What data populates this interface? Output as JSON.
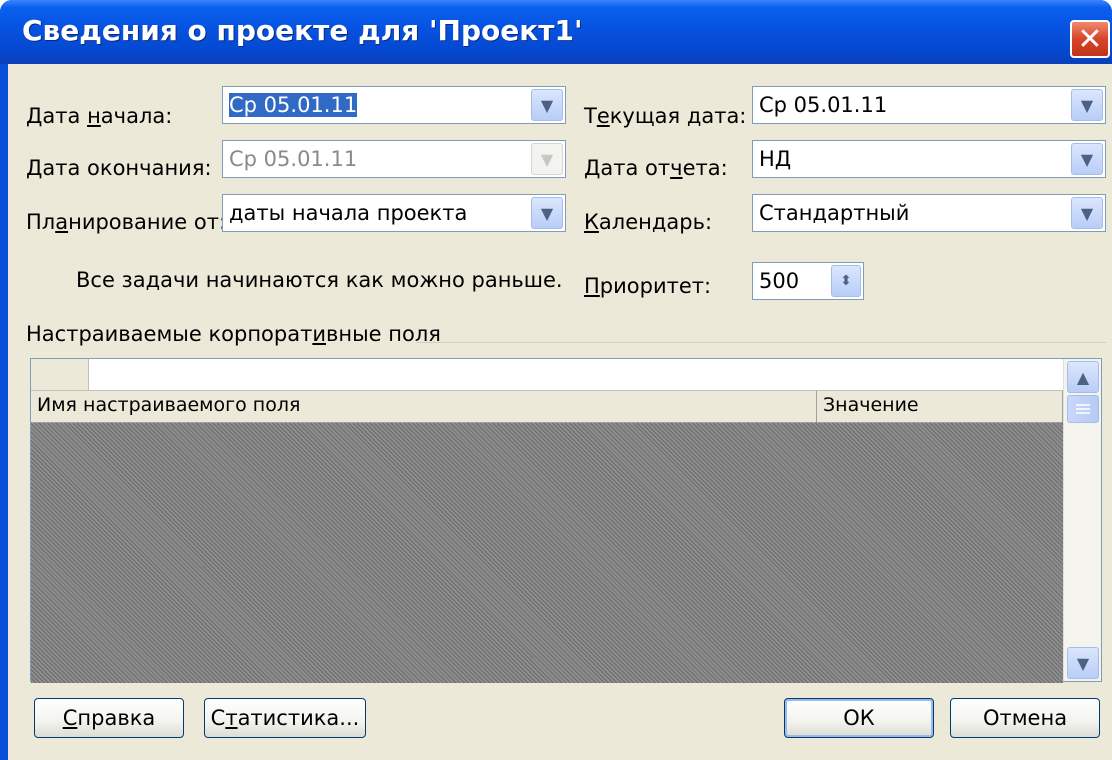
{
  "window": {
    "title": "Сведения о проекте для 'Проект1'",
    "close_glyph": "✕"
  },
  "left": {
    "start_label_pre": "Дата ",
    "start_label_u": "н",
    "start_label_post": "ачала:",
    "start_value": "Ср 05.01.11",
    "finish_label_pre": "",
    "finish_label_u": "Д",
    "finish_label_post": "ата окончания:",
    "finish_value": "Ср 05.01.11",
    "schedule_label_pre": "Пл",
    "schedule_label_u": "а",
    "schedule_label_post": "нирование от:",
    "schedule_value": "даты начала проекта",
    "note": "Все задачи начинаются как можно раньше."
  },
  "right": {
    "current_label_pre": "Т",
    "current_label_u": "е",
    "current_label_post": "кущая дата:",
    "current_value": "Ср 05.01.11",
    "status_label_pre": "Дата от",
    "status_label_u": "ч",
    "status_label_post": "ета:",
    "status_value": "НД",
    "calendar_label_pre": "",
    "calendar_label_u": "К",
    "calendar_label_post": "алендарь:",
    "calendar_value": "Стандартный",
    "priority_label_pre": "",
    "priority_label_u": "П",
    "priority_label_post": "риоритет:",
    "priority_value": "500"
  },
  "custom_fields": {
    "group_label_pre": "Настраиваемые корпорат",
    "group_label_u": "и",
    "group_label_post": "вные поля",
    "columns": [
      "Имя настраиваемого поля",
      "Значение"
    ]
  },
  "buttons": {
    "help_u": "С",
    "help_post": "правка",
    "stats_pre": "С",
    "stats_u": "т",
    "stats_post": "атистика...",
    "ok": "ОК",
    "cancel": "Отмена"
  },
  "icons": {
    "dropdown": "chevron-down-icon",
    "spinner": "spinner-arrows-icon",
    "scroll_up": "arrow-up-icon",
    "scroll_down": "arrow-down-icon"
  },
  "colors": {
    "titlebar": "#0652e0",
    "dialog_bg": "#ece9d8",
    "selection": "#316ac5",
    "close": "#d8452a"
  }
}
